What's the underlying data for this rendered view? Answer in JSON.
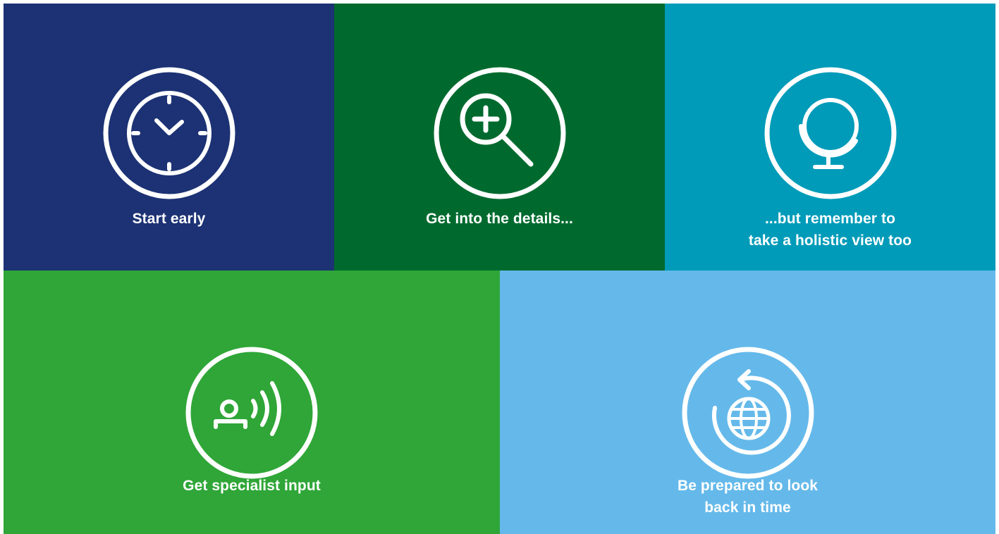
{
  "tiles": [
    {
      "id": "start",
      "color": "#1c3274",
      "icon": "clock-icon",
      "label_lines": [
        "Start early"
      ]
    },
    {
      "id": "details",
      "color": "#006a2e",
      "icon": "zoom-in-icon",
      "label_lines": [
        "Get into the details..."
      ]
    },
    {
      "id": "holistic",
      "color": "#009bb9",
      "icon": "globe-icon",
      "label_lines": [
        "...but remember to",
        "take a holistic view too"
      ]
    },
    {
      "id": "specialist",
      "color": "#2fa637",
      "icon": "speaking-person-icon",
      "label_lines": [
        "Get specialist input"
      ]
    },
    {
      "id": "lookback",
      "color": "#65b9ea",
      "icon": "history-globe-icon",
      "label_lines": [
        "Be prepared to look",
        "back in time"
      ]
    }
  ]
}
